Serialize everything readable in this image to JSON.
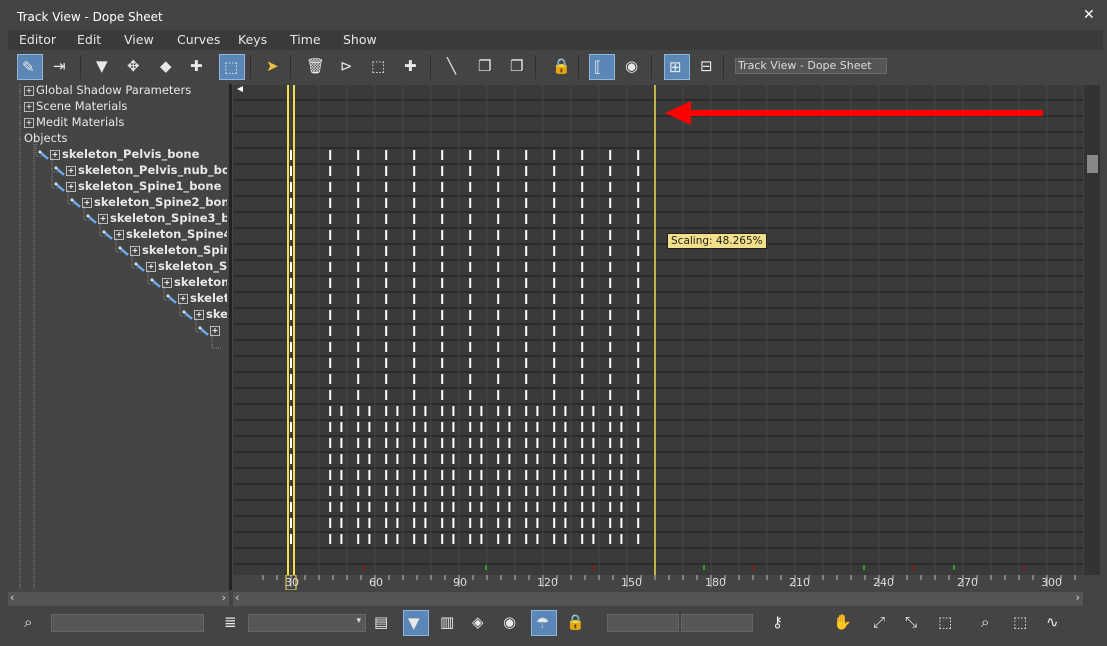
{
  "window": {
    "title": "Track View - Dope Sheet",
    "close_label": "✕"
  },
  "menu": [
    "Editor",
    "Edit",
    "View",
    "Curves",
    "Keys",
    "Time",
    "Show"
  ],
  "toolbar": {
    "icons": [
      "filter-curve-icon",
      "slide-keys-icon",
      "filter-icon",
      "move-keys-icon",
      "slide-key-icon",
      "add-key-icon",
      "select-range-icon",
      "select-pointer-icon",
      "delete-key-icon",
      "trim-icon",
      "scale-time-icon",
      "insert-time-icon",
      "break-tangent-icon",
      "copy-icon",
      "paste-icon",
      "lock-selection-icon",
      "snap-frames-icon",
      "show-keyable-icon",
      "hierarchy-icon",
      "layout-icon"
    ],
    "name_field": "Track View - Dope Sheet"
  },
  "tree": [
    {
      "label": "Global Shadow Parameters",
      "bold": false,
      "indent": 0,
      "bone": false
    },
    {
      "label": "Scene Materials",
      "bold": false,
      "indent": 0,
      "bone": false
    },
    {
      "label": "Medit Materials",
      "bold": false,
      "indent": 0,
      "bone": false
    },
    {
      "label": "Objects",
      "bold": false,
      "indent": 0,
      "bone": false,
      "noexpand": true
    },
    {
      "label": "skeleton_Pelvis_bone",
      "bold": true,
      "indent": 1,
      "bone": true
    },
    {
      "label": "skeleton_Pelvis_nub_bon",
      "bold": true,
      "indent": 2,
      "bone": true
    },
    {
      "label": "skeleton_Spine1_bone",
      "bold": true,
      "indent": 2,
      "bone": true
    },
    {
      "label": "skeleton_Spine2_bone",
      "bold": true,
      "indent": 3,
      "bone": true
    },
    {
      "label": "skeleton_Spine3_bo",
      "bold": true,
      "indent": 4,
      "bone": true
    },
    {
      "label": "skeleton_Spine4_",
      "bold": true,
      "indent": 5,
      "bone": true
    },
    {
      "label": "skeleton_Spin",
      "bold": true,
      "indent": 6,
      "bone": true
    },
    {
      "label": "skeleton_S",
      "bold": true,
      "indent": 7,
      "bone": true
    },
    {
      "label": "skeleton",
      "bold": true,
      "indent": 8,
      "bone": true
    },
    {
      "label": "skelet",
      "bold": true,
      "indent": 9,
      "bone": true
    },
    {
      "label": "ske",
      "bold": true,
      "indent": 10,
      "bone": true
    },
    {
      "label": "",
      "bold": true,
      "indent": 11,
      "bone": true
    },
    {
      "label": "",
      "bold": true,
      "indent": 12,
      "bone": false
    }
  ],
  "ruler": {
    "labels": [
      "30",
      "60",
      "90",
      "120",
      "150",
      "180",
      "210",
      "240",
      "270",
      "300"
    ]
  },
  "dope": {
    "tooltip": "Scaling: 48.265%",
    "key_frames_upper": [
      30,
      44,
      54,
      64,
      74,
      84,
      94,
      104,
      114,
      124,
      134,
      144,
      154
    ],
    "key_frames_lower": [
      30,
      44,
      48,
      54,
      58,
      64,
      68,
      74,
      78,
      84,
      88,
      94,
      98,
      104,
      108,
      114,
      118,
      124,
      128,
      134,
      138,
      144,
      148,
      154
    ],
    "scale_origin_frame": 30,
    "scale_end_frame": 160
  },
  "colors": {
    "accent": "#5b87b7",
    "highlight_line": "#f0e050",
    "arrow": "#ff0000",
    "key": "#ffffff"
  },
  "bottombar": {
    "icons": [
      "zoom-icon",
      "filter-list-icon",
      "key-filter-icon",
      "copy-keys-icon",
      "lock-icon",
      "key-icon",
      "pan-icon",
      "zoom-horizontal-icon",
      "zoom-region-icon",
      "frame-icon"
    ]
  }
}
